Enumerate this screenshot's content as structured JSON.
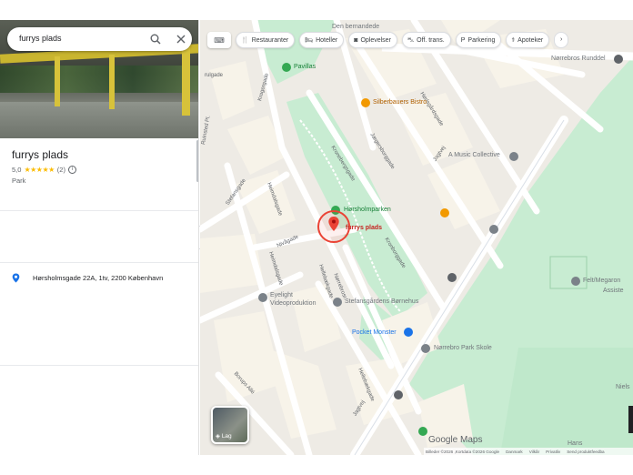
{
  "search": {
    "query": "furrys plads"
  },
  "place": {
    "name": "furrys plads",
    "rating": "5,0",
    "stars": "★★★★★",
    "reviews": "(2)",
    "type": "Park",
    "address": "Hørsholmsgade 22A, 1tv, 2200 København"
  },
  "chips": [
    {
      "icon": "fork-knife-icon",
      "glyph": "🍴",
      "label": "Restauranter"
    },
    {
      "icon": "bed-icon",
      "glyph": "🛏",
      "label": "Hoteller"
    },
    {
      "icon": "camera-icon",
      "glyph": "◙",
      "label": "Oplevelser"
    },
    {
      "icon": "transit-icon",
      "glyph": "⛍",
      "label": "Off. trans."
    },
    {
      "icon": "parking-icon",
      "glyph": "P",
      "label": "Parkering"
    },
    {
      "icon": "pharmacy-icon",
      "glyph": "⚕",
      "label": "Apoteker"
    }
  ],
  "map": {
    "labels": {
      "den_hernandede": "Den bernandede",
      "pavillas": "Pavillas",
      "norrebros_runddel": "Nørrebros Runddel",
      "silberbauers": "Silberbauers Bistro",
      "music_collective": "A Music Collective",
      "horsholmparken": "Hørsholmparken",
      "furrys_plads": "furrys plads",
      "felt_megaron": "Felt/Megaron",
      "assiste": "Assiste",
      "eyelight_1": "Eyelight",
      "eyelight_2": "Videoproduktion",
      "stefansgarden": "Stefansgårdens Børnehus",
      "pocket_monster": "Pocket Monster",
      "norrebro_park": "Nørrebro Park Skole",
      "niels": "Niels",
      "hans": "Hans"
    },
    "streets": {
      "krogergade": "Krogergade",
      "rulgade": "rulgade",
      "ruinsted": "Ruinsted Pl.",
      "stefansgade_1": "Stefansgade",
      "heimdalsgade": "Heimdalsgade",
      "kronebergsgade": "Kronebergsgade",
      "jagtvej_1": "Jagtvej",
      "jagtvej_2": "Jagtvej",
      "harekaersgade": "Hørlsgårdsgade",
      "jaegersborggade": "Jægersborggade",
      "herslebsgade": "Herslebsgade",
      "nivagade": "Nivågade",
      "heimdalsgade_2": "Heimdalsgade",
      "hellebaek": "Hellebækgade",
      "hellebaek_2": "Hellebækgade",
      "hornbaek": "Hornbækgade",
      "norreb": "Nørrebrosr.",
      "bornholm": "Stefansgade",
      "borups_alle": "Borups Allé",
      "jagtvej_3": "Jagtvej",
      "kronborggade": "Kronborggade"
    },
    "layers_label": "Lag",
    "google_logo": "Google Maps",
    "attribution": [
      "Billeder ©2026 ,Kortdata ©2026 Google",
      "Danmark",
      "Vilkår",
      "Privatliv",
      "Send produktfeedba"
    ]
  },
  "colors": {
    "park": "#c8ecd2",
    "park_dark": "#a8dfb7",
    "road": "#ffffff",
    "road_major": "#ffe9a8",
    "block": "#e9e5df",
    "pin": "#ea4335"
  }
}
